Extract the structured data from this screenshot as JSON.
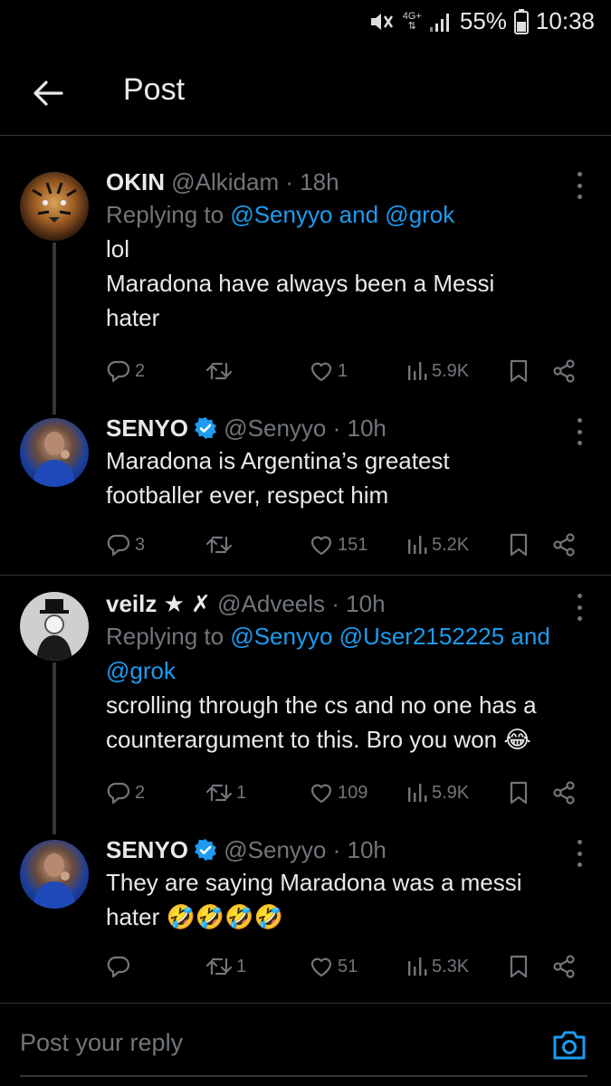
{
  "status_bar": {
    "network": "4G+",
    "battery": "55%",
    "time": "10:38"
  },
  "header": {
    "title": "Post"
  },
  "tweets": [
    {
      "name": "OKIN",
      "handle": "@Alkidam",
      "time": "· 18h",
      "reply_prefix": "Replying to",
      "reply_mentions_1": "@Senyyo",
      "reply_and": "and",
      "reply_mentions_2": "@grok",
      "text_line1": "lol",
      "text_line2": "Maradona have always been a Messi",
      "text_line3": "hater",
      "replies": "2",
      "reposts": "",
      "likes": "1",
      "views": "5.9K"
    },
    {
      "name": "SENYO",
      "handle": "@Senyyo",
      "time": "· 10h",
      "verified": true,
      "text_line1": "Maradona is Argentina’s greatest",
      "text_line2": "footballer ever, respect him",
      "replies": "3",
      "reposts": "",
      "likes": "151",
      "views": "5.2K"
    },
    {
      "name": "veilz ★ ✗",
      "handle": "@Adveels",
      "time": "· 10h",
      "reply_prefix": "Replying to",
      "reply_mentions_1": "@Senyyo @User2152225",
      "reply_and": "and",
      "reply_mentions_2": "@grok",
      "text_line1": "scrolling through the cs and no one has a",
      "text_line2": "counterargument to this. Bro you won 😂",
      "replies": "2",
      "reposts": "1",
      "likes": "109",
      "views": "5.9K"
    },
    {
      "name": "SENYO",
      "handle": "@Senyyo",
      "time": "· 10h",
      "verified": true,
      "text_line1": "They are saying Maradona was a messi",
      "text_line2": "hater 🤣🤣🤣🤣",
      "replies": "",
      "reposts": "1",
      "likes": "51",
      "views": "5.3K"
    }
  ],
  "reply_bar": {
    "placeholder": "Post your reply"
  },
  "icons": [
    "back-arrow-icon",
    "more-icon",
    "reply-icon",
    "repost-icon",
    "like-icon",
    "views-icon",
    "bookmark-icon",
    "share-icon",
    "camera-icon",
    "verified-icon"
  ],
  "colors": {
    "accent": "#1d9bf0",
    "muted": "#71767b",
    "text": "#e7e9ea",
    "background": "#000000"
  }
}
